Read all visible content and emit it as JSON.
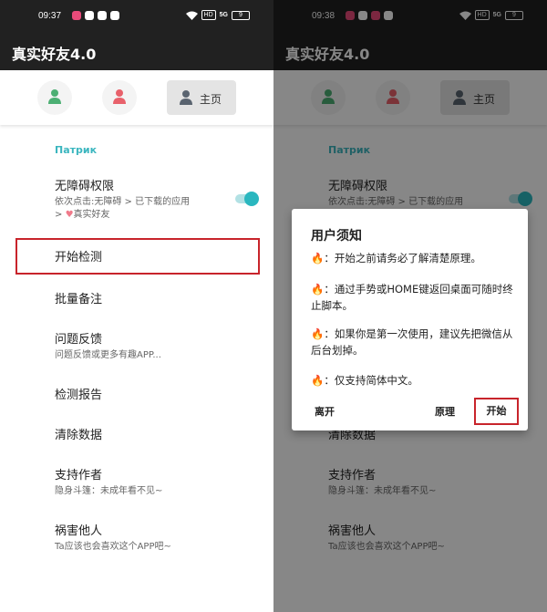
{
  "status_bar": {
    "left_time": "09:37",
    "right_time": "09:38",
    "network_tag": "HD",
    "signal_text": "5G",
    "battery": "9"
  },
  "app": {
    "title": "真实好友4.0"
  },
  "tabs": {
    "home_label": "主页",
    "icon_colors": [
      "#4caf73",
      "#e8616b",
      "#5a6470"
    ]
  },
  "section_label": "Патрик",
  "menu": {
    "accessibility": {
      "title": "无障碍权限",
      "sub_line1": "依次点击:无障碍 > 已下载的应用",
      "sub_line2_prefix": "> ",
      "sub_line2_suffix": "真实好友"
    },
    "start_detect": "开始检测",
    "batch_note": "批量备注",
    "feedback": {
      "title": "问题反馈",
      "sub": "问题反馈或更多有趣APP..."
    },
    "report": "检测报告",
    "clear": "清除数据",
    "support": {
      "title": "支持作者",
      "sub": "隐身斗篷：未成年看不见~"
    },
    "harm": {
      "title": "祸害他人",
      "sub": "Ta应该也会喜欢这个APP吧~"
    }
  },
  "dialog": {
    "title": "用户须知",
    "lines": [
      "：开始之前请务必了解清楚原理。",
      "：通过手势或HOME键返回桌面可随时终止脚本。",
      "：如果你是第一次使用，建议先把微信从后台划掉。",
      "：仅支持简体中文。"
    ],
    "leave": "离开",
    "principle": "原理",
    "start": "开始"
  },
  "colors": {
    "accent": "#2ab7bf",
    "highlight": "#c8242b",
    "appbar": "#212121"
  }
}
